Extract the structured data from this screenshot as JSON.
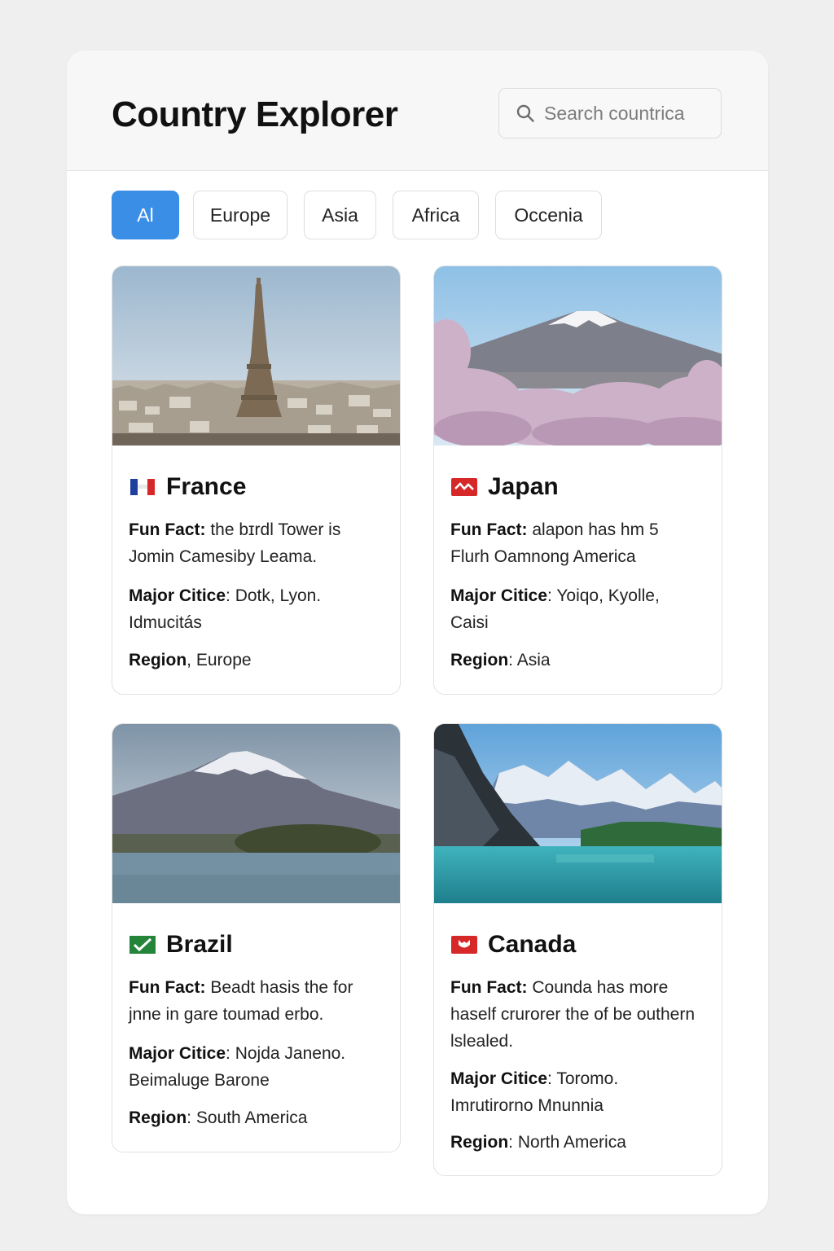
{
  "app": {
    "title": "Country Explorer",
    "search": {
      "placeholder": "Search countrica",
      "value": ""
    }
  },
  "filters": [
    {
      "label": "Al",
      "active": true
    },
    {
      "label": "Europe",
      "active": false
    },
    {
      "label": "Asia",
      "active": false
    },
    {
      "label": "Africa",
      "active": false
    },
    {
      "label": "Occenia",
      "active": false
    }
  ],
  "labels": {
    "fun_fact": "Fun Fact:",
    "major_cities": "Major Citice",
    "region": "Region"
  },
  "countries": [
    {
      "name": "France",
      "flag_icon": "france-flag-icon",
      "fun_fact": "the bɪrdl Tower is Jomin Camesiby Leama.",
      "major_cities": "Dotk, Lyon. Idmucitás",
      "region": "Europe",
      "image": "paris-tower-cityscape"
    },
    {
      "name": "Japan",
      "flag_icon": "japan-flag-icon",
      "fun_fact": "alapon has hm 5 Flurh Oamnong America",
      "major_cities": "Yoiqo, Kyolle, Caisi",
      "region": "Asia",
      "image": "mount-fuji-cherry-blossoms"
    },
    {
      "name": "Brazil",
      "flag_icon": "brazil-flag-icon",
      "fun_fact": "Beadt hasis the for jnne in gare toumad erbo.",
      "major_cities": "Nojda Janeno. Beimaluge Barone",
      "region": "South America",
      "image": "snowy-mountain-lake"
    },
    {
      "name": "Canada",
      "flag_icon": "canada-flag-icon",
      "fun_fact": "Counda has more haself crurorer the of be outhern lslealed.",
      "major_cities": "Toromo. Imrutirorno Mnunnia",
      "region": "North America",
      "image": "rocky-mountains-turquoise-lake"
    }
  ],
  "colors": {
    "accent": "#3a8ee6",
    "background": "#efefef",
    "panel": "#ffffff",
    "header": "#f7f7f7"
  }
}
